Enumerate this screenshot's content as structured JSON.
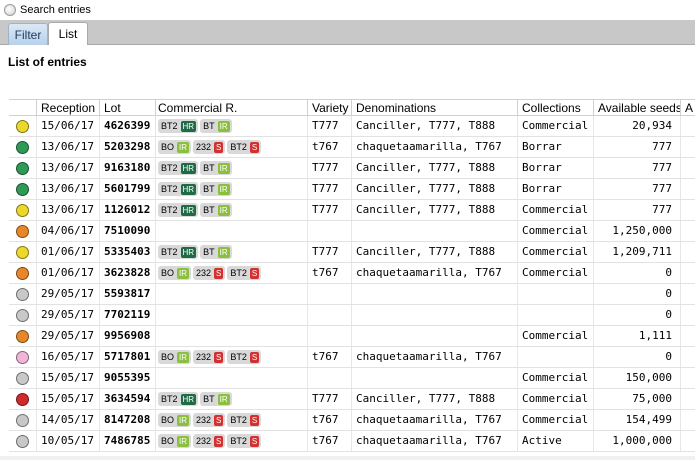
{
  "window": {
    "title": "Search entries",
    "icon": "search-app-icon"
  },
  "tabs": [
    {
      "label": "Filter",
      "active": false
    },
    {
      "label": "List",
      "active": true
    }
  ],
  "section_title": "List of entries",
  "columns": [
    "",
    "Reception",
    "Lot",
    "Commercial R.",
    "Variety",
    "Denominations",
    "Collections",
    "Available seeds",
    "A"
  ],
  "colors": {
    "yellow": "#ecd82a",
    "green": "#2e9a55",
    "orange": "#e8862a",
    "gray": "#c8c8c8",
    "pink": "#f0b6d8",
    "red": "#d02a2a",
    "badge_hr": "#1f6b45",
    "badge_ir": "#8cbf3f",
    "badge_s": "#d33030"
  },
  "rows": [
    {
      "status": "yellow",
      "reception": "15/06/17",
      "lot": "4626399",
      "badges": [
        [
          "BT2",
          "HR"
        ],
        [
          "BT",
          "IR"
        ]
      ],
      "variety": "T777",
      "denominations": "Canciller, T777, T888",
      "collection": "Commercial",
      "available": "20,934"
    },
    {
      "status": "green",
      "reception": "13/06/17",
      "lot": "5203298",
      "badges": [
        [
          "BO",
          "IR"
        ],
        [
          "232",
          "S"
        ],
        [
          "BT2",
          "S"
        ]
      ],
      "variety": "t767",
      "denominations": "chaquetaamarilla, T767",
      "collection": "Borrar",
      "available": "777"
    },
    {
      "status": "green",
      "reception": "13/06/17",
      "lot": "9163180",
      "badges": [
        [
          "BT2",
          "HR"
        ],
        [
          "BT",
          "IR"
        ]
      ],
      "variety": "T777",
      "denominations": "Canciller, T777, T888",
      "collection": "Borrar",
      "available": "777"
    },
    {
      "status": "green",
      "reception": "13/06/17",
      "lot": "5601799",
      "badges": [
        [
          "BT2",
          "HR"
        ],
        [
          "BT",
          "IR"
        ]
      ],
      "variety": "T777",
      "denominations": "Canciller, T777, T888",
      "collection": "Borrar",
      "available": "777"
    },
    {
      "status": "yellow",
      "reception": "13/06/17",
      "lot": "1126012",
      "badges": [
        [
          "BT2",
          "HR"
        ],
        [
          "BT",
          "IR"
        ]
      ],
      "variety": "T777",
      "denominations": "Canciller, T777, T888",
      "collection": "Commercial",
      "available": "777"
    },
    {
      "status": "orange",
      "reception": "04/06/17",
      "lot": "7510090",
      "badges": [],
      "variety": "",
      "denominations": "",
      "collection": "Commercial",
      "available": "1,250,000"
    },
    {
      "status": "yellow",
      "reception": "01/06/17",
      "lot": "5335403",
      "badges": [
        [
          "BT2",
          "HR"
        ],
        [
          "BT",
          "IR"
        ]
      ],
      "variety": "T777",
      "denominations": "Canciller, T777, T888",
      "collection": "Commercial",
      "available": "1,209,711"
    },
    {
      "status": "orange",
      "reception": "01/06/17",
      "lot": "3623828",
      "badges": [
        [
          "BO",
          "IR"
        ],
        [
          "232",
          "S"
        ],
        [
          "BT2",
          "S"
        ]
      ],
      "variety": "t767",
      "denominations": "chaquetaamarilla, T767",
      "collection": "Commercial",
      "available": "0"
    },
    {
      "status": "gray",
      "reception": "29/05/17",
      "lot": "5593817",
      "badges": [],
      "variety": "",
      "denominations": "",
      "collection": "",
      "available": "0"
    },
    {
      "status": "gray",
      "reception": "29/05/17",
      "lot": "7702119",
      "badges": [],
      "variety": "",
      "denominations": "",
      "collection": "",
      "available": "0"
    },
    {
      "status": "orange",
      "reception": "29/05/17",
      "lot": "9956908",
      "badges": [],
      "variety": "",
      "denominations": "",
      "collection": "Commercial",
      "available": "1,111"
    },
    {
      "status": "pink",
      "reception": "16/05/17",
      "lot": "5717801",
      "badges": [
        [
          "BO",
          "IR"
        ],
        [
          "232",
          "S"
        ],
        [
          "BT2",
          "S"
        ]
      ],
      "variety": "t767",
      "denominations": "chaquetaamarilla, T767",
      "collection": "",
      "available": "0"
    },
    {
      "status": "gray",
      "reception": "15/05/17",
      "lot": "9055395",
      "badges": [],
      "variety": "",
      "denominations": "",
      "collection": "Commercial",
      "available": "150,000"
    },
    {
      "status": "red",
      "reception": "15/05/17",
      "lot": "3634594",
      "badges": [
        [
          "BT2",
          "HR"
        ],
        [
          "BT",
          "IR"
        ]
      ],
      "variety": "T777",
      "denominations": "Canciller, T777, T888",
      "collection": "Commercial",
      "available": "75,000"
    },
    {
      "status": "gray",
      "reception": "14/05/17",
      "lot": "8147208",
      "badges": [
        [
          "BO",
          "IR"
        ],
        [
          "232",
          "S"
        ],
        [
          "BT2",
          "S"
        ]
      ],
      "variety": "t767",
      "denominations": "chaquetaamarilla, T767",
      "collection": "Commercial",
      "available": "154,499"
    },
    {
      "status": "gray",
      "reception": "10/05/17",
      "lot": "7486785",
      "badges": [
        [
          "BO",
          "IR"
        ],
        [
          "232",
          "S"
        ],
        [
          "BT2",
          "S"
        ]
      ],
      "variety": "t767",
      "denominations": "chaquetaamarilla, T767",
      "collection": "Active",
      "available": "1,000,000"
    }
  ]
}
